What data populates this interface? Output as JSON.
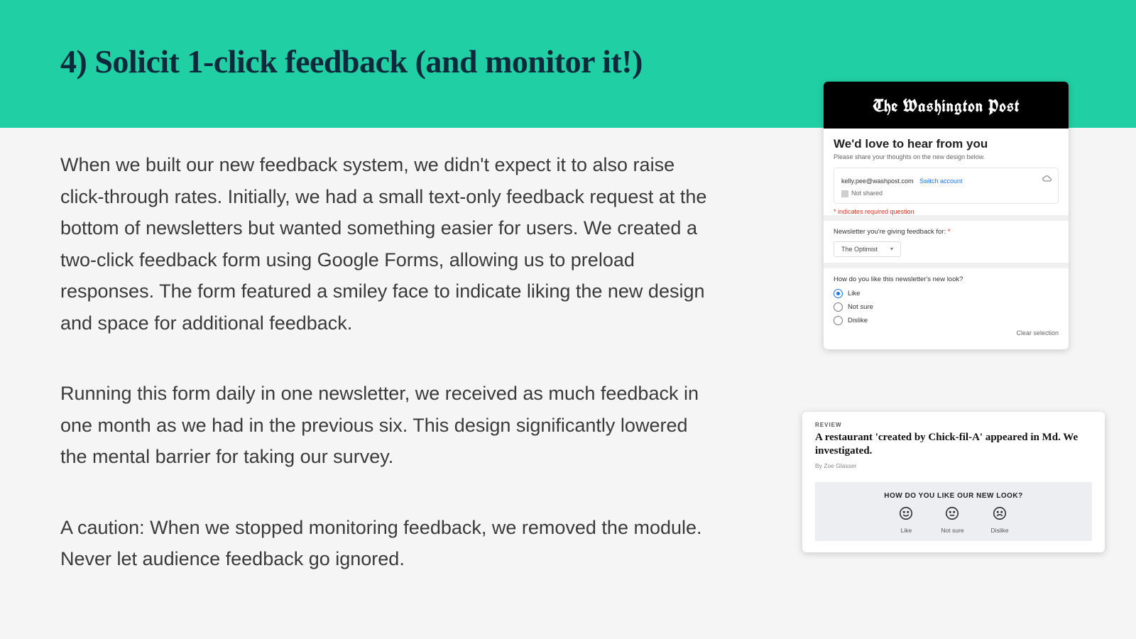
{
  "heading": "4) Solicit 1-click feedback (and monitor it!)",
  "paragraphs": {
    "p1": "When we built our new feedback system, we didn't expect it to also raise click-through rates. Initially, we had a small text-only feedback request at the bottom of newsletters but wanted something easier for users. We created a two-click feedback form using Google Forms, allowing us to preload responses. The form featured a smiley face to indicate liking the new design and space for additional feedback.",
    "p2": "Running this form daily in one newsletter, we received as much feedback in one month as we had in the previous six. This design significantly lowered the mental barrier for taking our survey.",
    "p3": "A caution: When we stopped monitoring feedback, we removed the module. Never let audience feedback go ignored."
  },
  "form": {
    "brand": "The Washington Post",
    "title": "We'd love to hear from you",
    "subtitle": "Please share your thoughts on the new design below.",
    "email": "kelly.pee@washpost.com",
    "switch": "Switch account",
    "not_shared": "Not shared",
    "required_note": "* indicates required question",
    "q_newsletter": "Newsletter you're giving feedback for: ",
    "dropdown_value": "The Optimist",
    "q_like": "How do you like this newsletter's new look?",
    "opt_like": "Like",
    "opt_notsure": "Not sure",
    "opt_dislike": "Dislike",
    "clear": "Clear selection"
  },
  "article": {
    "kicker": "REVIEW",
    "title": "A restaurant 'created by Chick-fil-A' appeared in Md. We investigated.",
    "byline": "By Zoe Glasser",
    "rate_q": "HOW DO YOU LIKE OUR NEW LOOK?",
    "like": "Like",
    "notsure": "Not sure",
    "dislike": "Dislike"
  }
}
